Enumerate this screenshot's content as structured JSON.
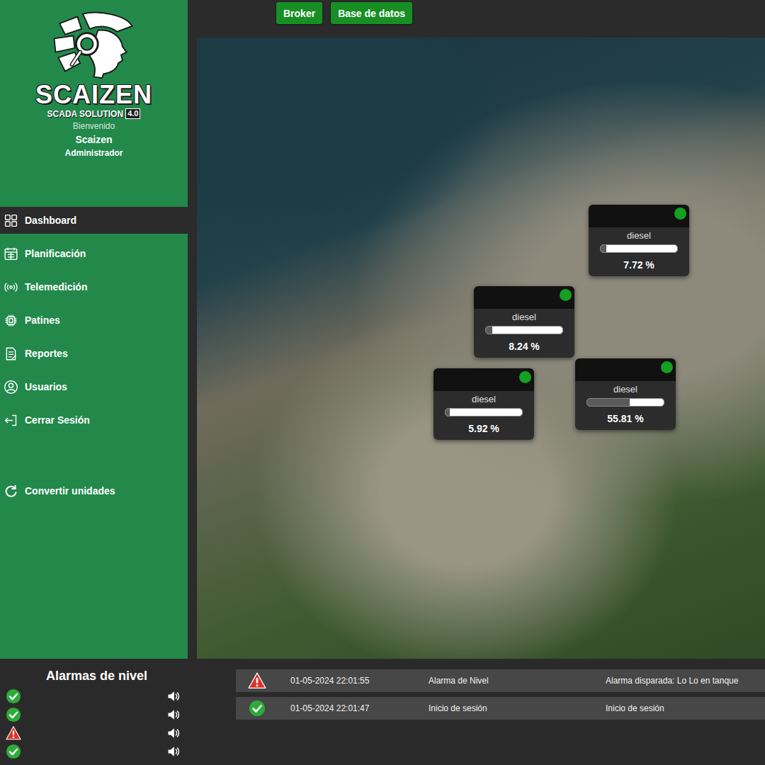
{
  "logo": {
    "brand": "SCAIZEN",
    "subtitle": "SCADA SOLUTION",
    "version": "4.0"
  },
  "user": {
    "greeting": "Bienvenido",
    "name": "Scaizen",
    "role": "Administrador"
  },
  "sidebar": {
    "items": [
      {
        "label": "Dashboard",
        "selected": true
      },
      {
        "label": "Planificación",
        "selected": false
      },
      {
        "label": "Telemedición",
        "selected": false
      },
      {
        "label": "Patines",
        "selected": false
      },
      {
        "label": "Reportes",
        "selected": false
      },
      {
        "label": "Usuarios",
        "selected": false
      },
      {
        "label": "Cerrar Sesión",
        "selected": false
      }
    ],
    "utility": {
      "label": "Convertir unidades"
    }
  },
  "top_bar": {
    "buttons": [
      "Broker",
      "Base de datos"
    ]
  },
  "map": {
    "tanks": [
      {
        "product": "diesel",
        "level": 0.0772,
        "reading": "7.72 %",
        "online": true
      },
      {
        "product": "diesel",
        "level": 0.0824,
        "reading": "8.24 %",
        "online": true
      },
      {
        "product": "diesel",
        "level": 0.0592,
        "reading": "5.92 %",
        "online": true
      },
      {
        "product": "diesel",
        "level": 0.5581,
        "reading": "55.81 %",
        "online": true
      }
    ]
  },
  "level_alarms": {
    "title": "Alarmas de nivel",
    "items": [
      {
        "alarm": false
      },
      {
        "alarm": false
      },
      {
        "alarm": true
      },
      {
        "alarm": false
      }
    ]
  },
  "event_log": [
    {
      "kind": "alarm",
      "time": "01-05-2024 22:01:55",
      "type": "Alarma de Nivel",
      "message": "Alarma disparada: Lo Lo en tanque"
    },
    {
      "kind": "ok",
      "time": "01-05-2024 22:01:47",
      "type": "Inicio de sesión",
      "message": "Inicio de sesión"
    }
  ]
}
